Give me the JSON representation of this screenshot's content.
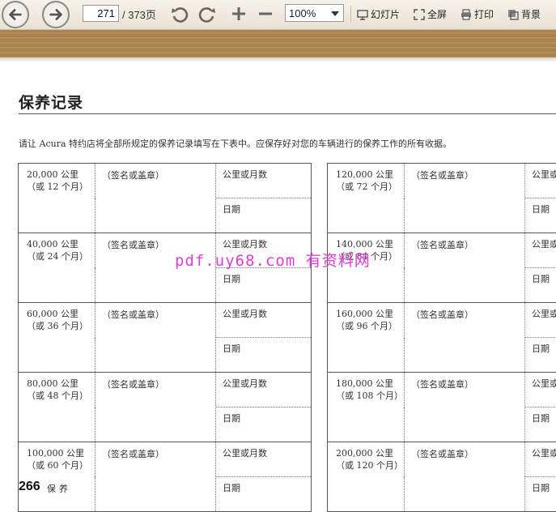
{
  "toolbar": {
    "current_page": "271",
    "page_total": "/ 373页",
    "zoom": "100%",
    "slideshow_label": "幻灯片",
    "fullscreen_label": "全屏",
    "print_label": "打印",
    "background_label": "背景"
  },
  "page": {
    "title": "保养记录",
    "intro": "请让 Acura 特约店将全部所规定的保养记录填写在下表中。应保存好对您的车辆进行的保养工作的所有收据。",
    "watermark": "pdf.uy68.com 有资料网",
    "page_number": "266",
    "footer_label": "保养"
  },
  "records_left": [
    {
      "mileage": "20,000 公里",
      "period": "（或 12 个月）",
      "sign": "（签名或盖章）",
      "km": "公里或月数",
      "date": "日期"
    },
    {
      "mileage": "40,000 公里",
      "period": "（或 24 个月）",
      "sign": "（签名或盖章）",
      "km": "公里或月数",
      "date": "日期"
    },
    {
      "mileage": "60,000 公里",
      "period": "（或 36 个月）",
      "sign": "（签名或盖章）",
      "km": "公里或月数",
      "date": "日期"
    },
    {
      "mileage": "80,000 公里",
      "period": "（或 48 个月）",
      "sign": "（签名或盖章）",
      "km": "公里或月数",
      "date": "日期"
    },
    {
      "mileage": "100,000 公里",
      "period": "（或 60 个月）",
      "sign": "（签名或盖章）",
      "km": "公里或月数",
      "date": "日期"
    }
  ],
  "records_right": [
    {
      "mileage": "120,000 公里",
      "period": "（或 72 个月）",
      "sign": "（签名或盖章）",
      "km": "公里或",
      "date": "日期"
    },
    {
      "mileage": "140,000 公里",
      "period": "（或 84 个月）",
      "sign": "（签名或盖章）",
      "km": "公里或",
      "date": "日期"
    },
    {
      "mileage": "160,000 公里",
      "period": "（或 96 个月）",
      "sign": "（签名或盖章）",
      "km": "公里或",
      "date": "日期"
    },
    {
      "mileage": "180,000 公里",
      "period": "（或 108 个月）",
      "sign": "（签名或盖章）",
      "km": "公里或",
      "date": "日期"
    },
    {
      "mileage": "200,000 公里",
      "period": "（或 120 个月）",
      "sign": "（签名或盖章）",
      "km": "公里或",
      "date": "日期"
    }
  ]
}
